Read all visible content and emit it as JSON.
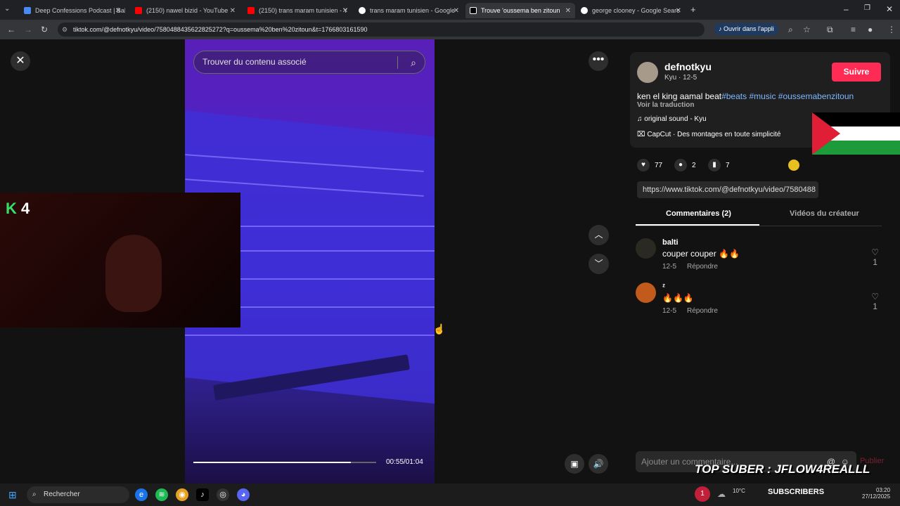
{
  "browser": {
    "tabs": [
      {
        "title": "Deep Confessions Podcast | Bal",
        "color": "#4a8af4"
      },
      {
        "title": "(2150) nawel bizid - YouTube",
        "color": "#ff0000"
      },
      {
        "title": "(2150) trans maram tunisien - Y",
        "color": "#ff0000"
      },
      {
        "title": "trans maram tunisien - Google",
        "color": "#ffffff"
      },
      {
        "title": "Trouve 'oussema ben zitoun",
        "color": "#000000"
      },
      {
        "title": "george clooney - Google Searc",
        "color": "#ffffff"
      }
    ],
    "url": "tiktok.com/@defnotkyu/video/7580488435622825272?q=oussema%20ben%20zitoun&t=1766803161590",
    "open_app_label": "Ouvrir dans l'appli"
  },
  "video": {
    "search_placeholder": "Trouver du contenu associé",
    "time": "00:55/01:04",
    "progress": 0.86
  },
  "webcam": {
    "badge_letter": "K",
    "badge_number": "4"
  },
  "panel": {
    "username": "defnotkyu",
    "subline": "Kyu · 12-5",
    "follow_label": "Suivre",
    "caption_text": "ken el king aamal beat",
    "caption_tags": "#beats #music #oussemabenzitoun",
    "translate": "Voir la traduction",
    "sound": "original sound - Kyu",
    "capcut": "CapCut · Des montages en toute simplicité",
    "likes": "77",
    "comments_count": "2",
    "saves": "7",
    "link": "https://www.tiktok.com/@defnotkyu/video/7580488",
    "tab_comments": "Commentaires (2)",
    "tab_videos": "Vidéos du créateur",
    "comments": [
      {
        "name": "balti",
        "text": "couper couper 🔥🔥",
        "date": "12-5",
        "reply": "Répondre",
        "likes": "1"
      },
      {
        "name": "ᶻ",
        "text": "🔥🔥🔥",
        "date": "12-5",
        "reply": "Répondre",
        "likes": "1"
      }
    ],
    "comment_placeholder": "Ajouter un commentaire...",
    "publish": "Publier"
  },
  "overlay": {
    "text": "TOP SUBER : JFLOW4REALLL"
  },
  "taskbar": {
    "search": "Rechercher",
    "notif": "1",
    "weather": "10°C",
    "subscribers": "SUBSCRIBERS",
    "time": "03:20",
    "date": "27/12/2025"
  }
}
